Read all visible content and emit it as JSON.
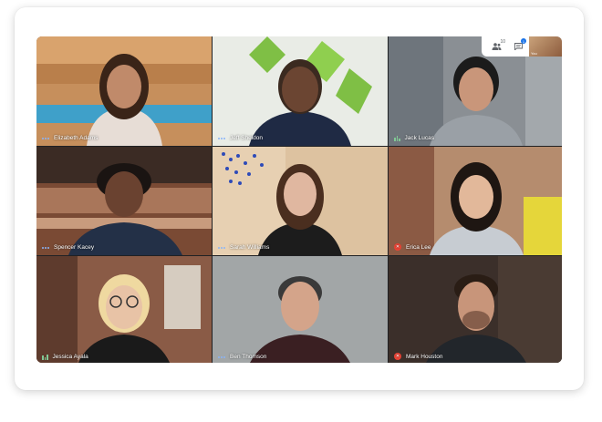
{
  "toolbar": {
    "participants_count": "10",
    "chat_count": "1",
    "self_label": "You"
  },
  "participants": [
    {
      "name": "Elizabeth Adams",
      "status": "speaking-dots"
    },
    {
      "name": "Jeff Sheldon",
      "status": "speaking-dots"
    },
    {
      "name": "Jack Lucas",
      "status": "audio-bars"
    },
    {
      "name": "Spencer Kacey",
      "status": "speaking-dots"
    },
    {
      "name": "Sarah Williams",
      "status": "speaking-dots"
    },
    {
      "name": "Erica Lee",
      "status": "muted"
    },
    {
      "name": "Jessica Ayala",
      "status": "audio-bars"
    },
    {
      "name": "Ben Thomson",
      "status": "speaking-dots"
    },
    {
      "name": "Mark Houston",
      "status": "muted"
    }
  ],
  "colors": {
    "speaking": "#8ab4f8",
    "audio": "#81c995",
    "muted": "#ea4335",
    "accent": "#1a73e8"
  }
}
